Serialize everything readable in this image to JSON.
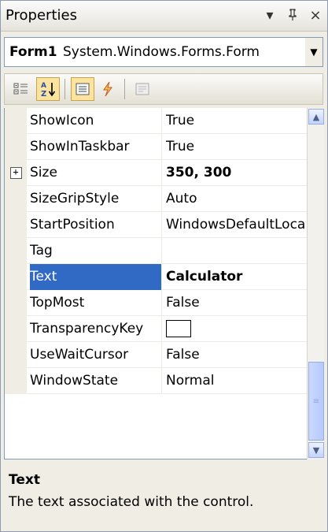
{
  "window": {
    "title": "Properties",
    "dropdown_icon": "▾",
    "pin_icon": "ᚋ",
    "close_icon": "×"
  },
  "object_selector": {
    "name": "Form1",
    "type": "System.Windows.Forms.Form"
  },
  "toolbar": {
    "buttons": [
      "categorized-icon",
      "alphabetical-icon",
      "properties-icon",
      "events-icon",
      "property-pages-icon"
    ]
  },
  "grid": {
    "rows": [
      {
        "name": "ShowIcon",
        "value": "True",
        "bold": false
      },
      {
        "name": "ShowInTaskbar",
        "value": "True",
        "bold": false
      },
      {
        "name": "Size",
        "value": "350, 300",
        "bold": true,
        "expandable": true
      },
      {
        "name": "SizeGripStyle",
        "value": "Auto",
        "bold": false
      },
      {
        "name": "StartPosition",
        "value": "WindowsDefaultLocation",
        "bold": false
      },
      {
        "name": "Tag",
        "value": "",
        "bold": false
      },
      {
        "name": "Text",
        "value": "Calculator",
        "bold": true,
        "selected": true
      },
      {
        "name": "TopMost",
        "value": "False",
        "bold": false
      },
      {
        "name": "TransparencyKey",
        "value": "",
        "bold": false,
        "swatch": true
      },
      {
        "name": "UseWaitCursor",
        "value": "False",
        "bold": false
      },
      {
        "name": "WindowState",
        "value": "Normal",
        "bold": false
      }
    ],
    "expand_symbol": "+"
  },
  "description": {
    "title": "Text",
    "text": "The text associated with the control."
  },
  "colors": {
    "selection": "#316ac5",
    "scroll_accent": "#97aee2"
  }
}
